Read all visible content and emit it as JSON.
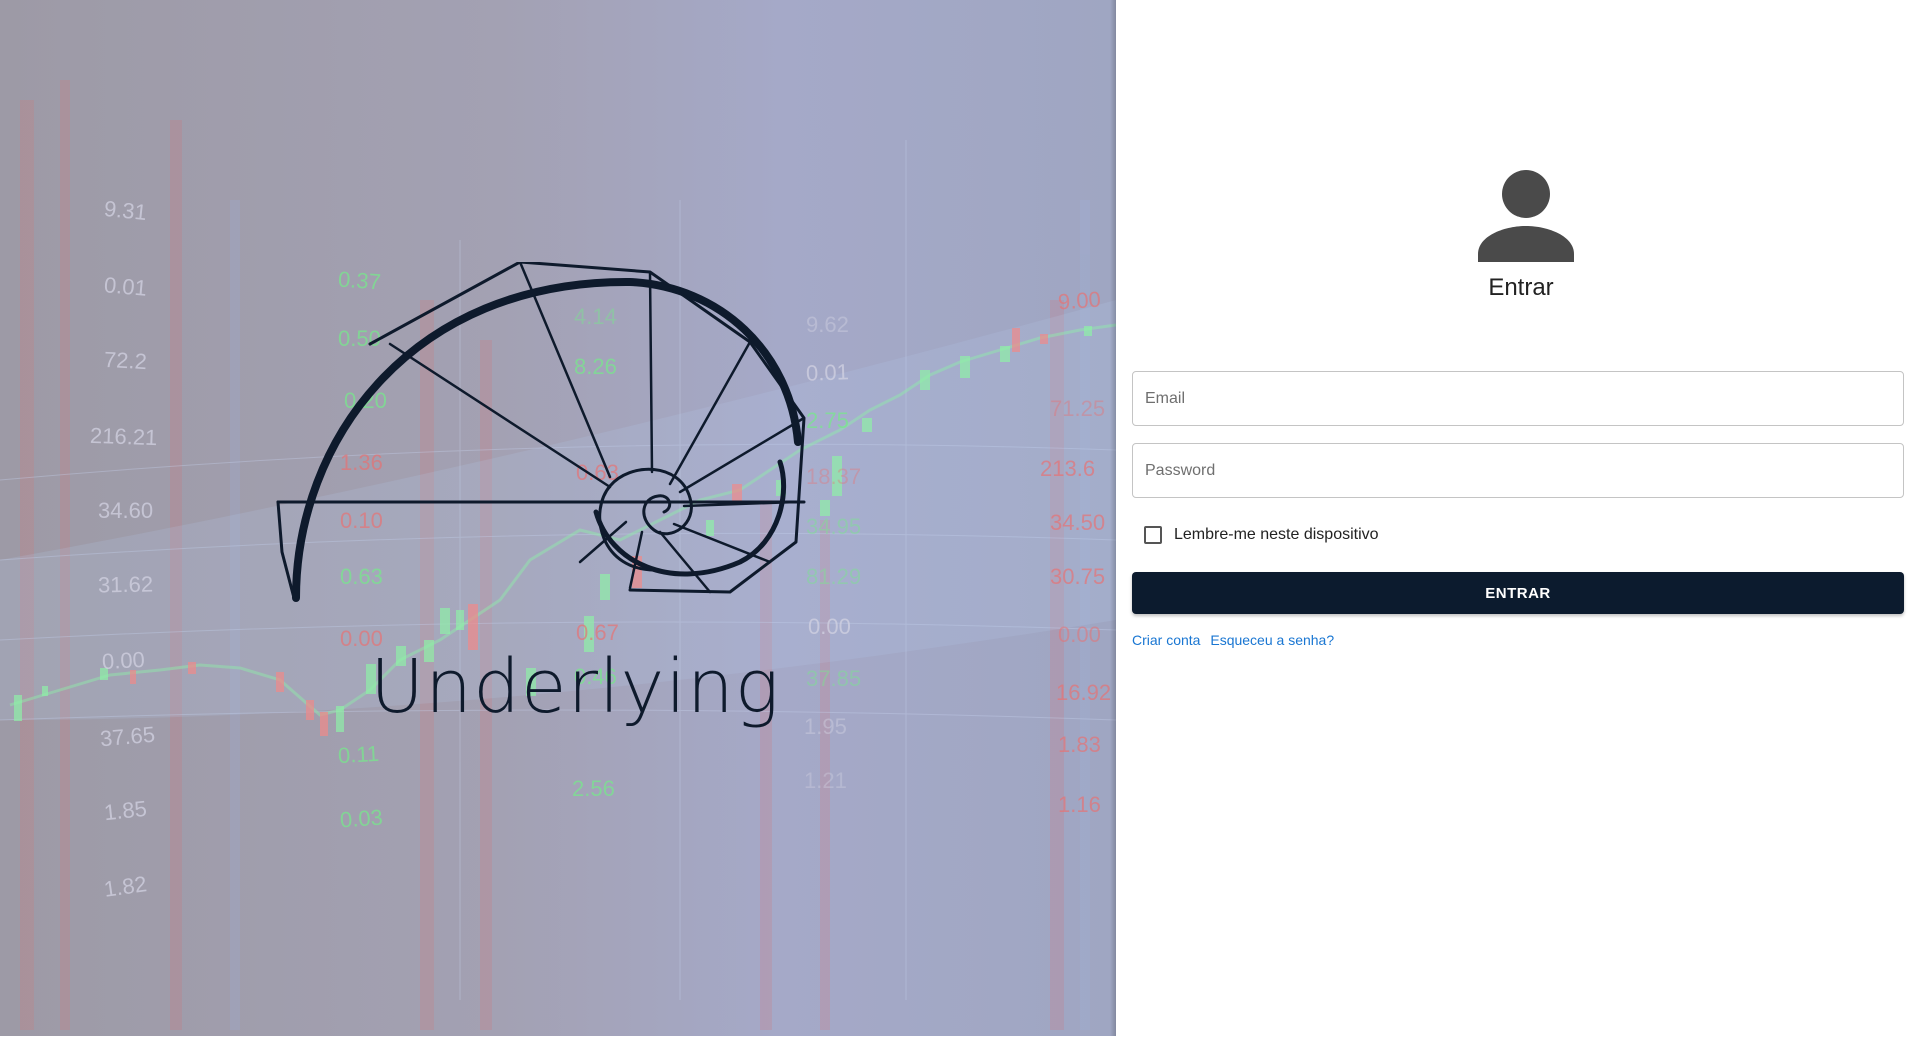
{
  "brand": {
    "name": "Underlying"
  },
  "background_ticker": {
    "grey_values": [
      "9.31",
      "0.01",
      "72.2",
      "216.21",
      "34.60",
      "31.62",
      "0.00",
      "37.65",
      "1.85",
      "1.82",
      "0.00",
      "0.01",
      "9.62",
      "1.95",
      "1.21"
    ],
    "green_values": [
      "0.37",
      "0.50",
      "0.20",
      "0.63",
      "4.14",
      "8.26",
      "2.75",
      "34.95",
      "81.29",
      "37.85",
      "0.11",
      "2.56",
      "0.03",
      "0.46"
    ],
    "red_values": [
      "0.00",
      "1.36",
      "0.10",
      "0.63",
      "0.67",
      "9.00",
      "71.25",
      "213.6",
      "34.50",
      "30.75",
      "0.00",
      "16.92",
      "1.83",
      "1.16",
      "18.37"
    ]
  },
  "login": {
    "title": "Entrar",
    "email_placeholder": "Email",
    "password_placeholder": "Password",
    "remember_label": "Lembre-me neste dispositivo",
    "remember_checked": false,
    "submit_label": "ENTRAR",
    "create_account_label": "Criar conta",
    "forgot_password_label": "Esqueceu a senha?"
  },
  "colors": {
    "submit_button": "#0c1b2e",
    "link": "#1976d2",
    "avatar": "#4a4a4a",
    "logo": "#0e1a2c"
  },
  "icons": {
    "avatar": "person-icon",
    "brand": "spiral-staircase-logo"
  }
}
